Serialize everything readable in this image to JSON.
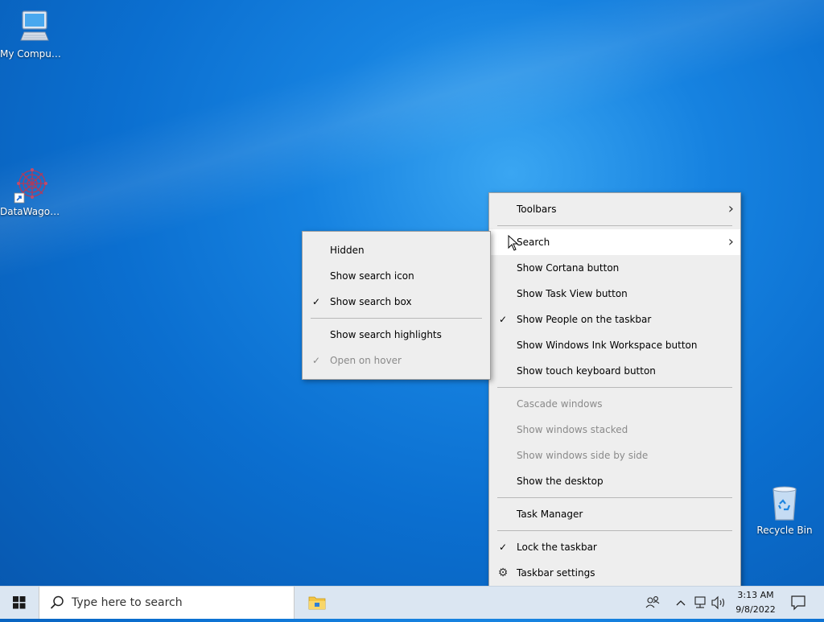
{
  "desktop": {
    "icons": {
      "my_computer": "My Computer",
      "datawagon": "DataWagon...",
      "recycle_bin": "Recycle Bin"
    }
  },
  "context_menu": {
    "items": {
      "toolbars": "Toolbars",
      "search": "Search",
      "show_cortana": "Show Cortana button",
      "show_task_view": "Show Task View button",
      "show_people": "Show People on the taskbar",
      "show_ink": "Show Windows Ink Workspace button",
      "show_touch_keyboard": "Show touch keyboard button",
      "cascade": "Cascade windows",
      "stacked": "Show windows stacked",
      "side_by_side": "Show windows side by side",
      "show_desktop": "Show the desktop",
      "task_manager": "Task Manager",
      "lock_taskbar": "Lock the taskbar",
      "taskbar_settings": "Taskbar settings"
    },
    "checked": [
      "show_people",
      "lock_taskbar"
    ],
    "disabled": [
      "cascade",
      "stacked",
      "side_by_side"
    ],
    "highlighted": "search"
  },
  "search_submenu": {
    "items": {
      "hidden": "Hidden",
      "show_icon": "Show search icon",
      "show_box": "Show search box",
      "show_highlights": "Show search highlights",
      "open_on_hover": "Open on hover"
    },
    "checked": [
      "show_box",
      "open_on_hover"
    ],
    "disabled": [
      "open_on_hover"
    ]
  },
  "taskbar": {
    "search_placeholder": "Type here to search",
    "clock_time": "3:13 AM",
    "clock_date": "9/8/2022"
  },
  "glyphs": {
    "check": "✓",
    "chevron": "›",
    "gear": "⚙"
  },
  "colors": {
    "menu_bg": "#eeeeee",
    "menu_highlight": "#ffffff",
    "disabled_text": "#8a8a8a",
    "taskbar_bg": "#dbe6f2"
  }
}
